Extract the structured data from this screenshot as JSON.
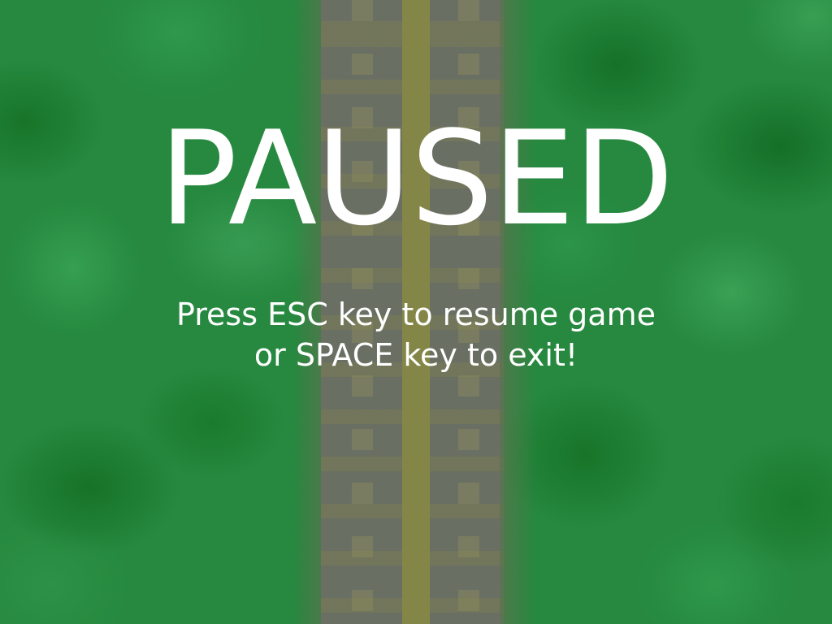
{
  "overlay": {
    "title": "PAUSED",
    "instructions": {
      "line1": "Press ESC key to resume game",
      "line2": "or SPACE key to exit!"
    }
  },
  "colors": {
    "grass": "#268a3f",
    "road": "#6f6f66",
    "center_line": "#8c8748",
    "text": "#ffffff"
  }
}
